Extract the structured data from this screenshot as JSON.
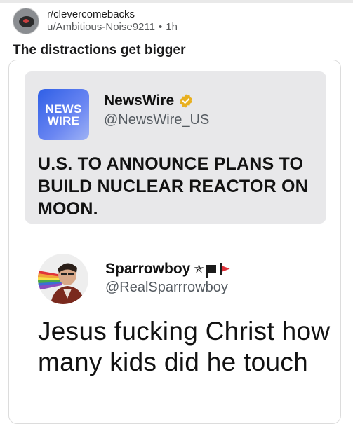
{
  "post": {
    "subreddit": "r/clevercomebacks",
    "username": "u/Ambitious-Noise9211",
    "separator": "•",
    "age": "1h",
    "title": "The distractions get bigger",
    "subreddit_icon": "subreddit-avatar-icon"
  },
  "quoted_tweet": {
    "logo_line1": "NEWS",
    "logo_line2": "WIRE",
    "display_name": "NewsWire",
    "handle": "@NewsWire_US",
    "verified_icon": "verified-badge-icon",
    "verified_color": "#e8b020",
    "text": "U.S. TO ANNOUNCE PLANS TO BUILD NUCLEAR REACTOR ON MOON."
  },
  "reply_tweet": {
    "display_name": "Sparrowboy",
    "name_emoji": "✯",
    "handle": "@RealSparrrowboy",
    "text": "Jesus fucking Christ how many kids did he touch",
    "avatar_icon": "profile-avatar-icon"
  },
  "colors": {
    "logo_blue": "#2f5fe6",
    "quote_bg": "#e8e8ea",
    "red_flag": "#e0323a"
  }
}
